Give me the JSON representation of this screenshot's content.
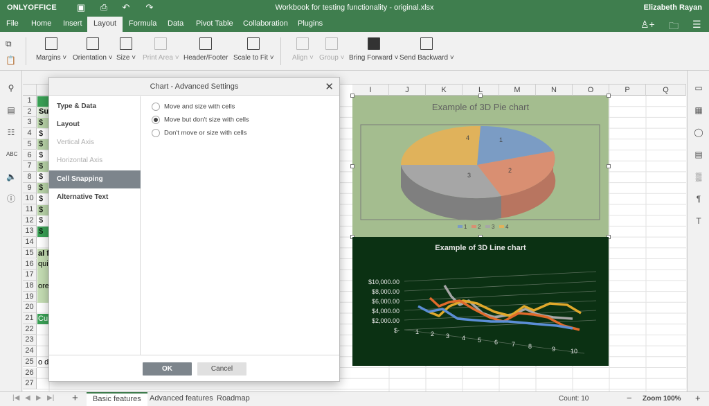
{
  "app": {
    "logo": "ONLYOFFICE",
    "document_title": "Workbook for testing functionality - original.xlsx",
    "user": "Elizabeth Rayan"
  },
  "menu": {
    "tabs": [
      "File",
      "Home",
      "Insert",
      "Layout",
      "Formula",
      "Data",
      "Pivot Table",
      "Collaboration",
      "Plugins"
    ],
    "active": "Layout"
  },
  "toolbar": {
    "margins": "Margins",
    "orientation": "Orientation",
    "size": "Size",
    "print_area": "Print Area",
    "header_footer": "Header/Footer",
    "scale_to_fit": "Scale to Fit",
    "align": "Align",
    "group": "Group",
    "bring_forward": "Bring Forward",
    "send_backward": "Send Backward"
  },
  "sheet": {
    "columns": [
      "I",
      "J",
      "K",
      "L",
      "M",
      "N",
      "O",
      "P",
      "Q"
    ],
    "rows": [
      "1",
      "2",
      "3",
      "4",
      "5",
      "6",
      "7",
      "8",
      "9",
      "10",
      "11",
      "12",
      "13",
      "14",
      "15",
      "16",
      "17",
      "18",
      "19",
      "20",
      "21",
      "22",
      "23",
      "24",
      "25",
      "26",
      "27"
    ],
    "cells": {
      "b2": "Su",
      "dollar": "$",
      "r15": "al f",
      "r16": "qui",
      "r18": "ore",
      "r21": "Cu",
      "r25": "o d"
    }
  },
  "pie_chart": {
    "title": "Example of 3D Pie chart",
    "slice_labels": [
      "1",
      "2",
      "3",
      "4"
    ],
    "legend": [
      "1",
      "2",
      "3",
      "4"
    ],
    "colors": [
      "#7b9cc4",
      "#d98f72",
      "#a6a6a6",
      "#e0b25b"
    ]
  },
  "chart_data": {
    "type": "line",
    "title": "Example of 3D Line chart",
    "x": [
      "1",
      "2",
      "3",
      "4",
      "5",
      "6",
      "7",
      "8",
      "9",
      "10"
    ],
    "y_ticks": [
      "$10,000.00",
      "$8,000.00",
      "$6,000.00",
      "$4,000.00",
      "$2,000.00",
      "$-"
    ],
    "colors": [
      "#5b8ed6",
      "#e06a2b",
      "#a6a6a6",
      "#e0a82b"
    ]
  },
  "dialog": {
    "title": "Chart - Advanced Settings",
    "nav": [
      "Type & Data",
      "Layout",
      "Vertical Axis",
      "Horizontal Axis",
      "Cell Snapping",
      "Alternative Text"
    ],
    "selected": "Cell Snapping",
    "options": [
      "Move and size with cells",
      "Move but don't size with cells",
      "Don't move or size with cells"
    ],
    "selected_option": "Move but don't size with cells",
    "ok": "OK",
    "cancel": "Cancel"
  },
  "status": {
    "sheets": [
      "Basic features",
      "Advanced features",
      "Roadmap"
    ],
    "active_sheet": "Basic features",
    "count": "Count: 10",
    "zoom": "Zoom 100%"
  }
}
